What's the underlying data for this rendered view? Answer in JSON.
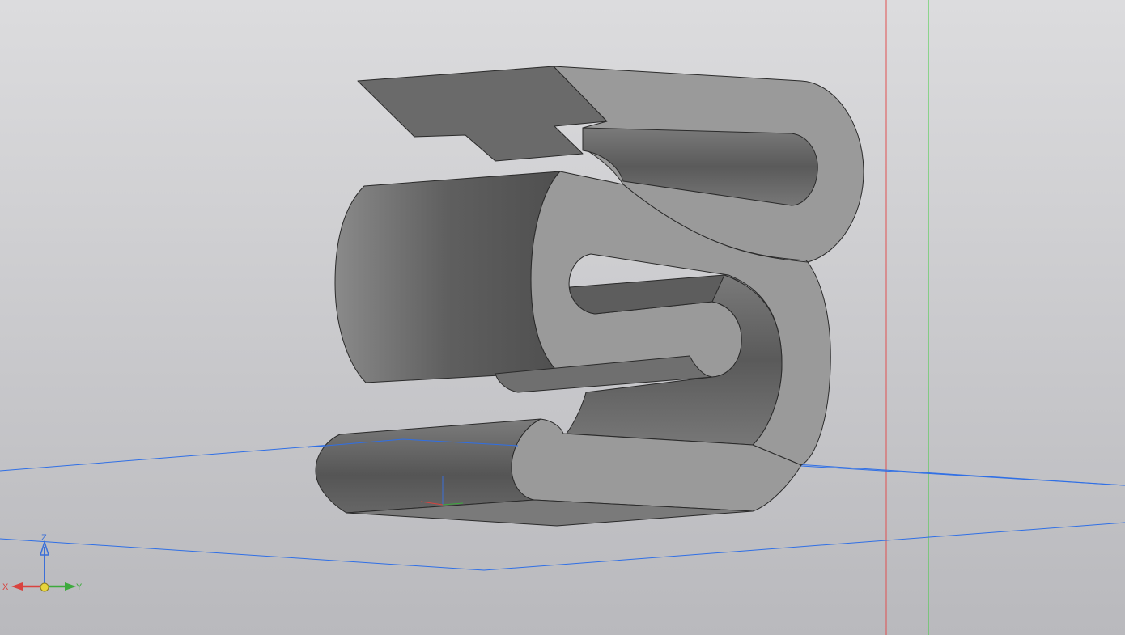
{
  "viewport": {
    "background_top": "#dcdcde",
    "background_bottom": "#b9b9bd"
  },
  "colors": {
    "red_axis_line": "#e05050",
    "green_axis_line": "#3ccc3c",
    "blue_plane": "#2f6fe6",
    "edge": "#2a2a2a",
    "face_light": "#9a9a9a",
    "face_dark": "#6a6a6a"
  },
  "triad": {
    "x_label": "X",
    "y_label": "Y",
    "z_label": "Z",
    "x_color": "#d9433f",
    "y_color": "#3daa3d",
    "z_color": "#3b6fd8",
    "origin_color": "#e7d43c"
  },
  "model": {
    "icon": "s-shaped-bent-sheet-metal-part"
  }
}
